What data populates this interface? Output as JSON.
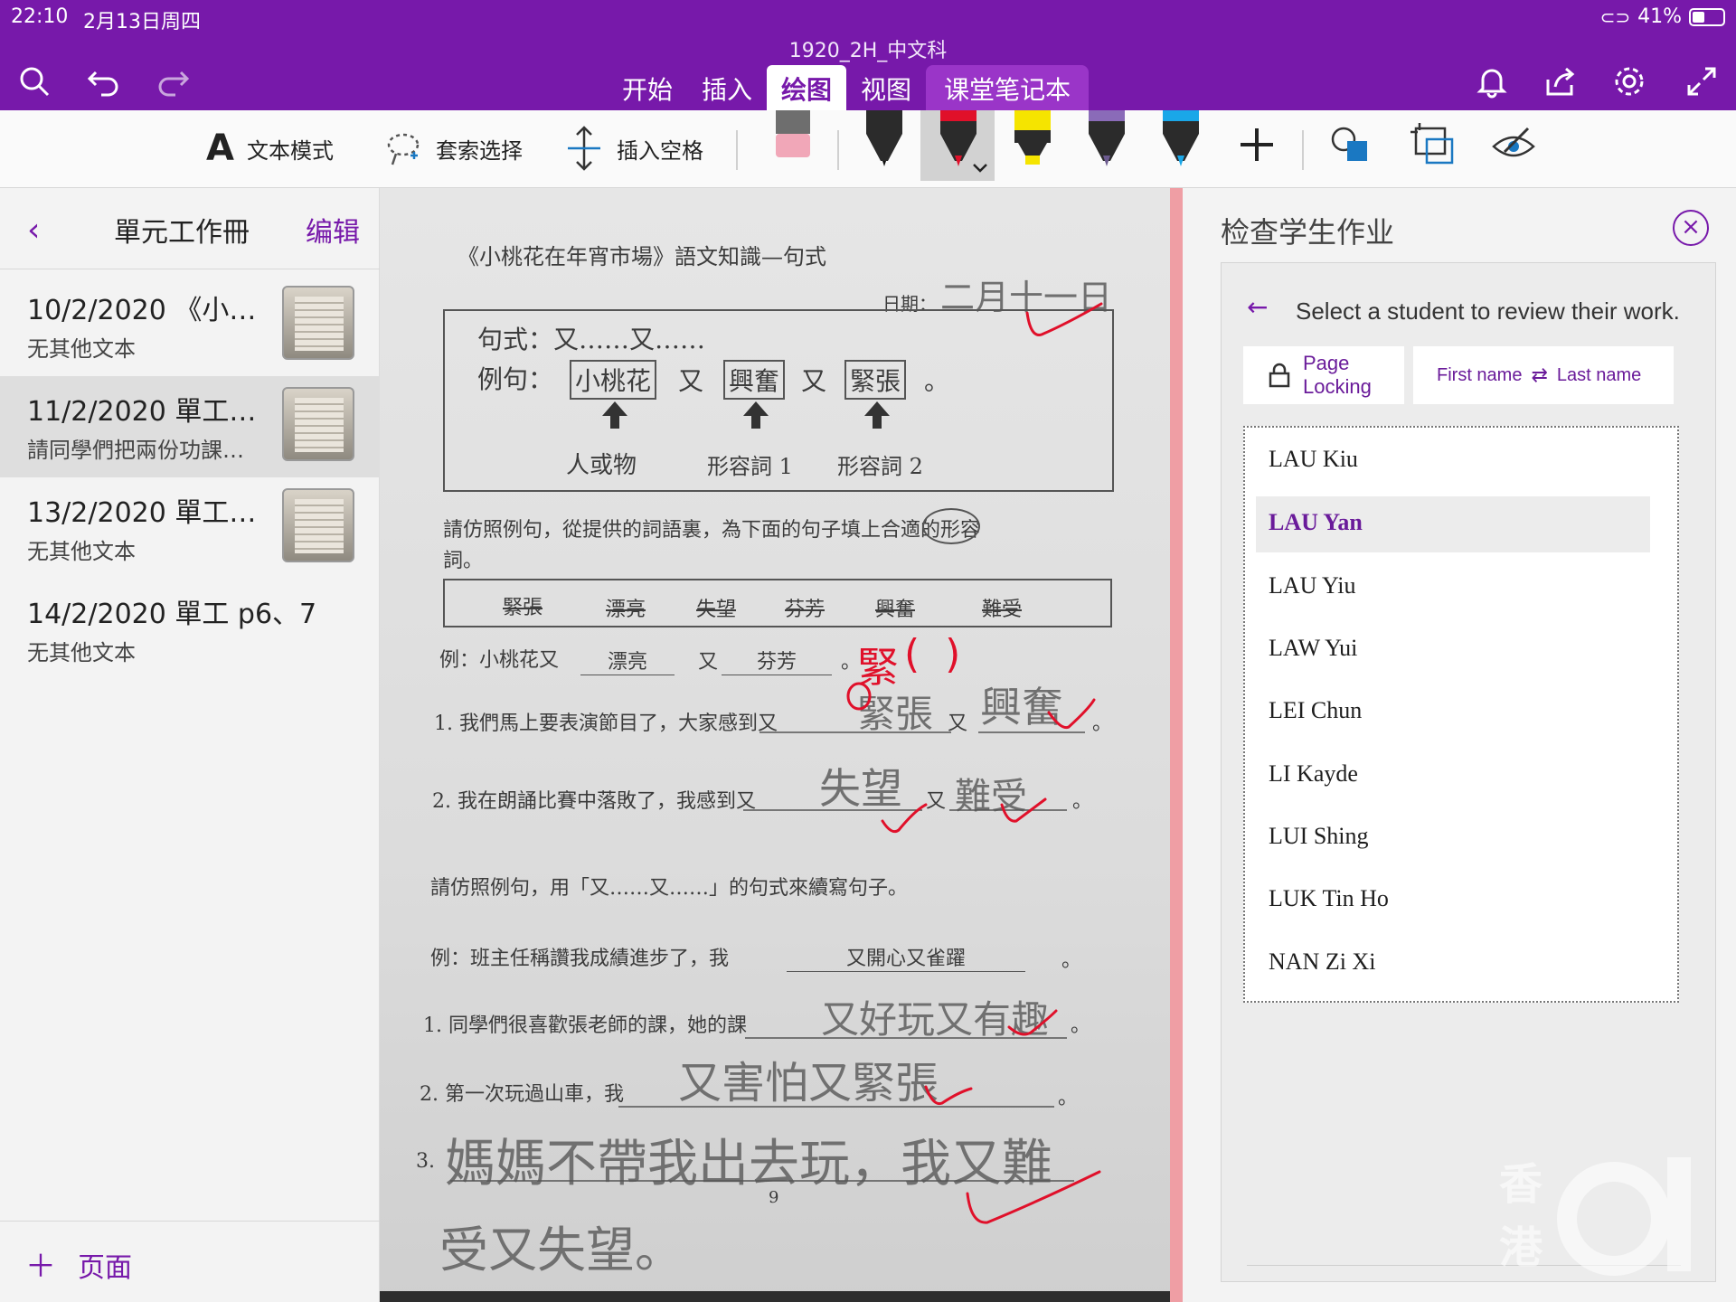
{
  "status": {
    "time": "22:10",
    "date": "2月13日周四",
    "battery": "41%",
    "battery_level": 0.41
  },
  "title": "1920_2H_中文科",
  "tabs": [
    "开始",
    "插入",
    "绘图",
    "视图",
    "课堂笔记本"
  ],
  "active_tab": "绘图",
  "toolbar": {
    "text_mode": "文本模式",
    "lasso": "套索选择",
    "insert_space": "插入空格",
    "pens": [
      "black-pen",
      "red-pen",
      "yellow-highlighter",
      "galaxy-pen",
      "blue-pen"
    ],
    "colors": {
      "black": "#1f1f1f",
      "red": "#e0102a",
      "yellow": "#f5e400",
      "galaxy": "#6b5a8e",
      "blue": "#1aa7e8"
    }
  },
  "nav": {
    "back": "‹",
    "section_title": "單元工作冊",
    "edit": "编辑",
    "pages": [
      {
        "title": "10/2/2020 《小…",
        "subtitle": "无其他文本",
        "has_thumb": true
      },
      {
        "title": "11/2/2020 單工…",
        "subtitle": "請同學們把兩份功課…",
        "has_thumb": true,
        "selected": true
      },
      {
        "title": "13/2/2020 單工…",
        "subtitle": "无其他文本",
        "has_thumb": true
      },
      {
        "title": "14/2/2020 單工 p6、7",
        "subtitle": "无其他文本",
        "has_thumb": false
      }
    ],
    "add_page": "页面"
  },
  "worksheet": {
    "heading": "《小桃花在年宵市場》語文知識—句式",
    "date_label": "日期：",
    "date_written": "二月十一日",
    "pattern": "句式：又……又……",
    "example_label": "例句：",
    "example_words": [
      "小桃花",
      "又",
      "興奮",
      "又",
      "緊張",
      "。"
    ],
    "labels": [
      "人或物",
      "形容詞 1",
      "形容詞 2"
    ],
    "instruction1": "請仿照例句，從提供的詞語裏，為下面的句子填上合適的形容",
    "instruction1b": "詞。",
    "word_bank": [
      "緊張",
      "漂亮",
      "失望",
      "芬芳",
      "興奮",
      "難受"
    ],
    "example_sentence": [
      "例：小桃花又",
      "漂亮",
      "又",
      "芬芳",
      "。"
    ],
    "q1": [
      "1. 我們馬上要表演節目了，大家感到又",
      "又",
      "。"
    ],
    "q1_answers": [
      "緊張",
      "興奮"
    ],
    "q2": [
      "2. 我在朗誦比賽中落敗了，我感到又",
      "又",
      "。"
    ],
    "q2_answers": [
      "失望",
      "難受"
    ],
    "instruction2": "請仿照例句，用「又……又……」的句式來續寫句子。",
    "example2": [
      "例：班主任稱讚我成績進步了，我",
      "又開心又雀躍",
      "。"
    ],
    "p1": [
      "1. 同學們很喜歡張老師的課，她的課",
      "。"
    ],
    "p1_answer": "又好玩又有趣",
    "p2": [
      "2. 第一次玩過山車，我",
      "。"
    ],
    "p2_answer": "又害怕又緊張",
    "p3_num": "3.",
    "p3_answer_line1": "媽媽不帶我出去玩，我又難",
    "p3_answer_line2": "受又失望。",
    "page_number": "9",
    "correction": "緊",
    "check": "✓"
  },
  "review": {
    "title": "检查学生作业",
    "instruction": "Select a student to review their work.",
    "page_locking": "Page Locking",
    "sort_first": "First name",
    "sort_last": "Last name",
    "students": [
      "LAU Kiu",
      "LAU Yan",
      "LAU Yiu",
      "LAW Yui",
      "LEI Chun",
      "LI Kayde",
      "LUI Shing",
      "LUK Tin Ho",
      "NAN Zi Xi"
    ],
    "selected_student": "LAU Yan"
  },
  "watermark": {
    "chars": [
      "香",
      "港"
    ],
    "mark": "01"
  }
}
